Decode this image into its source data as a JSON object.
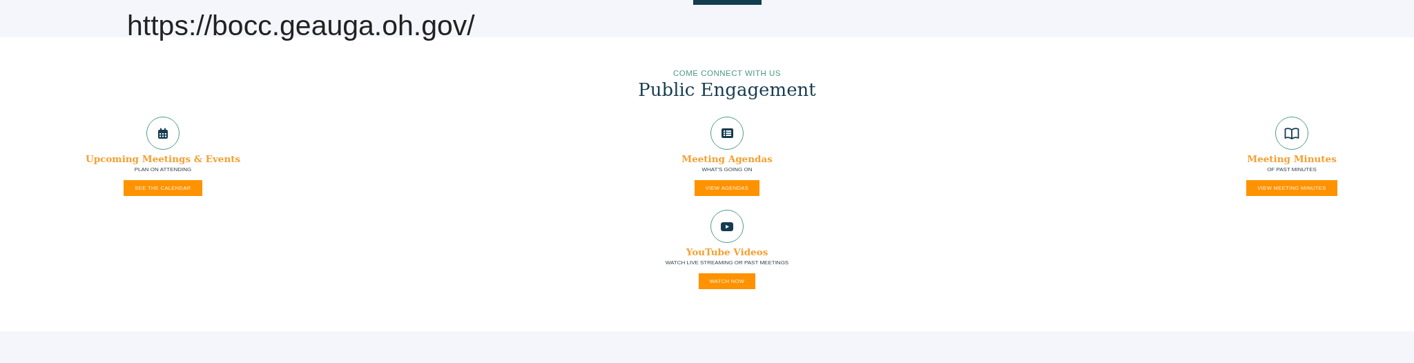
{
  "overlay_text": "https://bocc.geauga.oh.gov/",
  "section": {
    "eyebrow": "COME CONNECT WITH US",
    "title": "Public Engagement"
  },
  "cards": [
    {
      "title": "Upcoming Meetings & Events",
      "subtitle": "PLAN ON ATTENDING",
      "button": "SEE THE CALENDAR"
    },
    {
      "title": "Meeting Agendas",
      "subtitle": "WHAT'S GOING ON",
      "button": "VIEW AGENDAS"
    },
    {
      "title": "Meeting Minutes",
      "subtitle": "OF PAST MINUTES",
      "button": "VIEW MEETING MINUTES"
    },
    {
      "title": "YouTube Videos",
      "subtitle": "WATCH LIVE STREAMING OR PAST MEETINGS",
      "button": "WATCH NOW"
    }
  ]
}
